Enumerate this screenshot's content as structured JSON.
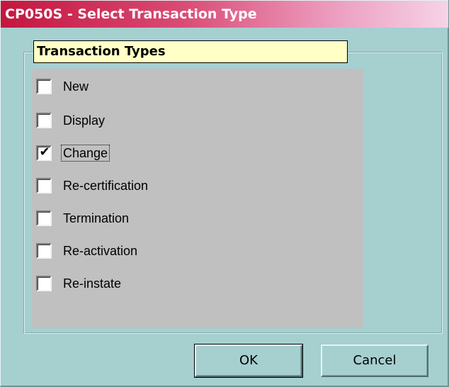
{
  "window": {
    "title": "CP050S - Select Transaction Type"
  },
  "group": {
    "label": "Transaction Types"
  },
  "options": [
    {
      "label": "New",
      "checked": false
    },
    {
      "label": "Display",
      "checked": false
    },
    {
      "label": "Change",
      "checked": true
    },
    {
      "label": "Re-certification",
      "checked": false
    },
    {
      "label": "Termination",
      "checked": false
    },
    {
      "label": "Re-activation",
      "checked": false
    },
    {
      "label": "Re-instate",
      "checked": false
    }
  ],
  "buttons": {
    "ok_label": "OK",
    "cancel_label": "Cancel"
  },
  "colors": {
    "window_bg": "#a6cfd0",
    "titlebar_start": "#c4163e",
    "titlebar_end": "#f6d3e6",
    "group_label_bg": "#ffffc6",
    "panel_bg": "#c0c0c0"
  }
}
